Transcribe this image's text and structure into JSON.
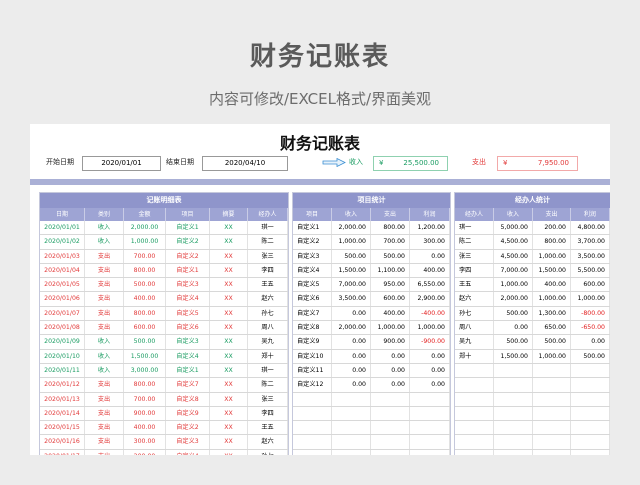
{
  "hero": {
    "title": "财务记账表",
    "subtitle": "内容可修改/EXCEL格式/界面美观"
  },
  "sheet": {
    "title": "财务记账表",
    "start_label": "开始日期",
    "start_value": "2020/01/01",
    "end_label": "结束日期",
    "end_value": "2020/04/10",
    "income_label": "收入",
    "income_currency": "¥",
    "income_value": "25,500.00",
    "expense_label": "支出",
    "expense_currency": "¥",
    "expense_value": "7,950.00"
  },
  "colors": {
    "accent": "#8f95cb",
    "income": "#1a9c62",
    "expense": "#e23a3a"
  },
  "detail": {
    "title": "记账明细表",
    "headers": [
      "日期",
      "类别",
      "金额",
      "项目",
      "摘要",
      "经办人"
    ],
    "rows": [
      [
        "2020/01/01",
        "收入",
        "2,000.00",
        "自定义1",
        "XX",
        "琪一"
      ],
      [
        "2020/01/02",
        "收入",
        "1,000.00",
        "自定义2",
        "XX",
        "陈二"
      ],
      [
        "2020/01/03",
        "支出",
        "700.00",
        "自定义2",
        "XX",
        "张三"
      ],
      [
        "2020/01/04",
        "支出",
        "800.00",
        "自定义1",
        "XX",
        "李四"
      ],
      [
        "2020/01/05",
        "支出",
        "500.00",
        "自定义3",
        "XX",
        "王五"
      ],
      [
        "2020/01/06",
        "支出",
        "400.00",
        "自定义4",
        "XX",
        "赵六"
      ],
      [
        "2020/01/07",
        "支出",
        "800.00",
        "自定义5",
        "XX",
        "孙七"
      ],
      [
        "2020/01/08",
        "支出",
        "600.00",
        "自定义6",
        "XX",
        "周八"
      ],
      [
        "2020/01/09",
        "收入",
        "500.00",
        "自定义3",
        "XX",
        "吴九"
      ],
      [
        "2020/01/10",
        "收入",
        "1,500.00",
        "自定义4",
        "XX",
        "郑十"
      ],
      [
        "2020/01/11",
        "收入",
        "3,000.00",
        "自定义1",
        "XX",
        "琪一"
      ],
      [
        "2020/01/12",
        "支出",
        "800.00",
        "自定义7",
        "XX",
        "陈二"
      ],
      [
        "2020/01/13",
        "支出",
        "700.00",
        "自定义8",
        "XX",
        "张三"
      ],
      [
        "2020/01/14",
        "支出",
        "900.00",
        "自定义9",
        "XX",
        "李四"
      ],
      [
        "2020/01/15",
        "支出",
        "400.00",
        "自定义2",
        "XX",
        "王五"
      ],
      [
        "2020/01/16",
        "支出",
        "300.00",
        "自定义3",
        "XX",
        "赵六"
      ],
      [
        "2020/01/17",
        "支出",
        "200.00",
        "自定义4",
        "XX",
        "孙七"
      ]
    ]
  },
  "project": {
    "title": "项目统计",
    "headers": [
      "项目",
      "收入",
      "支出",
      "利润"
    ],
    "rows": [
      [
        "自定义1",
        "2,000.00",
        "800.00",
        "1,200.00"
      ],
      [
        "自定义2",
        "1,000.00",
        "700.00",
        "300.00"
      ],
      [
        "自定义3",
        "500.00",
        "500.00",
        "0.00"
      ],
      [
        "自定义4",
        "1,500.00",
        "1,100.00",
        "400.00"
      ],
      [
        "自定义5",
        "7,000.00",
        "950.00",
        "6,550.00"
      ],
      [
        "自定义6",
        "3,500.00",
        "600.00",
        "2,900.00"
      ],
      [
        "自定义7",
        "0.00",
        "400.00",
        "-400.00"
      ],
      [
        "自定义8",
        "2,000.00",
        "1,000.00",
        "1,000.00"
      ],
      [
        "自定义9",
        "0.00",
        "900.00",
        "-900.00"
      ],
      [
        "自定义10",
        "0.00",
        "0.00",
        "0.00"
      ],
      [
        "自定义11",
        "0.00",
        "0.00",
        "0.00"
      ],
      [
        "自定义12",
        "0.00",
        "0.00",
        "0.00"
      ],
      [
        "",
        "",
        "",
        ""
      ],
      [
        "",
        "",
        "",
        ""
      ],
      [
        "",
        "",
        "",
        ""
      ],
      [
        "",
        "",
        "",
        ""
      ],
      [
        "",
        "",
        "",
        ""
      ]
    ]
  },
  "agent": {
    "title": "经办人统计",
    "headers": [
      "经办人",
      "收入",
      "支出",
      "利润"
    ],
    "rows": [
      [
        "琪一",
        "5,000.00",
        "200.00",
        "4,800.00"
      ],
      [
        "陈二",
        "4,500.00",
        "800.00",
        "3,700.00"
      ],
      [
        "张三",
        "4,500.00",
        "1,000.00",
        "3,500.00"
      ],
      [
        "李四",
        "7,000.00",
        "1,500.00",
        "5,500.00"
      ],
      [
        "王五",
        "1,000.00",
        "400.00",
        "600.00"
      ],
      [
        "赵六",
        "2,000.00",
        "1,000.00",
        "1,000.00"
      ],
      [
        "孙七",
        "500.00",
        "1,300.00",
        "-800.00"
      ],
      [
        "周八",
        "0.00",
        "650.00",
        "-650.00"
      ],
      [
        "吴九",
        "500.00",
        "500.00",
        "0.00"
      ],
      [
        "郑十",
        "1,500.00",
        "1,000.00",
        "500.00"
      ],
      [
        "",
        "",
        "",
        ""
      ],
      [
        "",
        "",
        "",
        ""
      ],
      [
        "",
        "",
        "",
        ""
      ],
      [
        "",
        "",
        "",
        ""
      ],
      [
        "",
        "",
        "",
        ""
      ],
      [
        "",
        "",
        "",
        ""
      ],
      [
        "",
        "",
        "",
        ""
      ]
    ]
  }
}
